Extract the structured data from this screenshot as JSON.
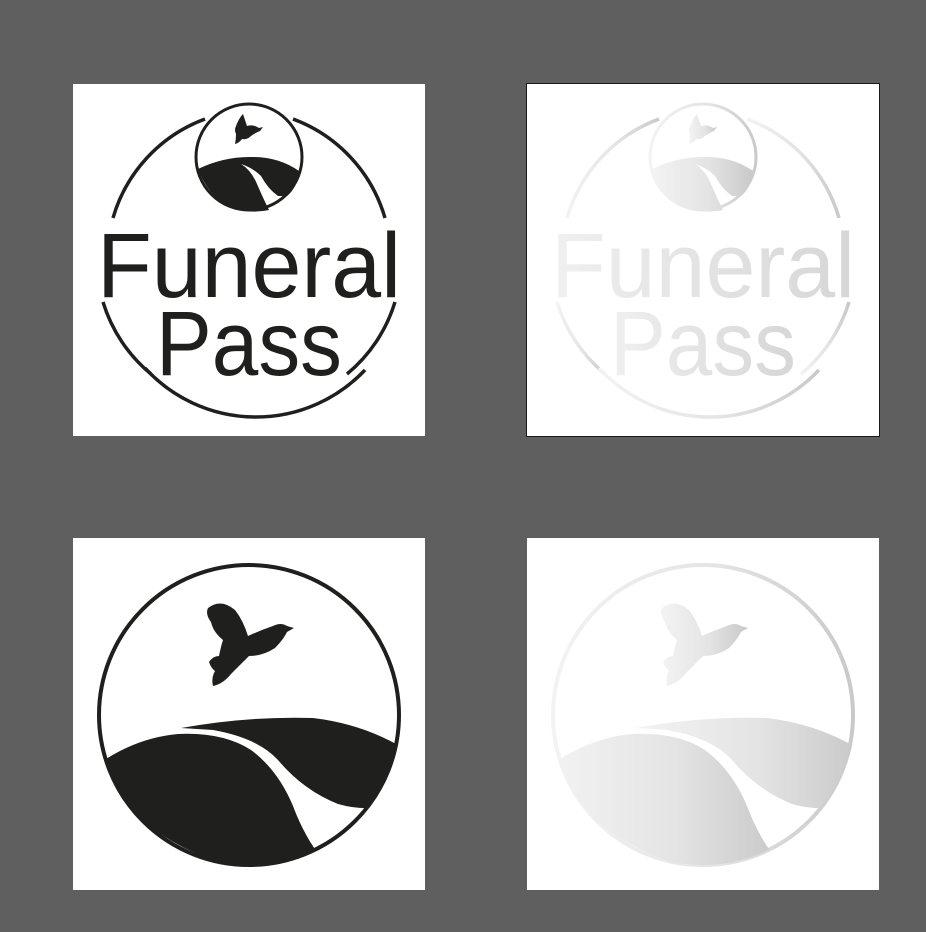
{
  "logo": {
    "line1": "Funeral",
    "line2": "Pass"
  },
  "colors": {
    "background": "#5f5f5f",
    "tile": "#ffffff",
    "ink": "#1f201e",
    "silver_light": "#f2f2f2",
    "silver_dark": "#c8c8c8"
  },
  "variants": [
    "black-full-logo",
    "silver-full-logo",
    "black-emblem",
    "silver-emblem"
  ]
}
